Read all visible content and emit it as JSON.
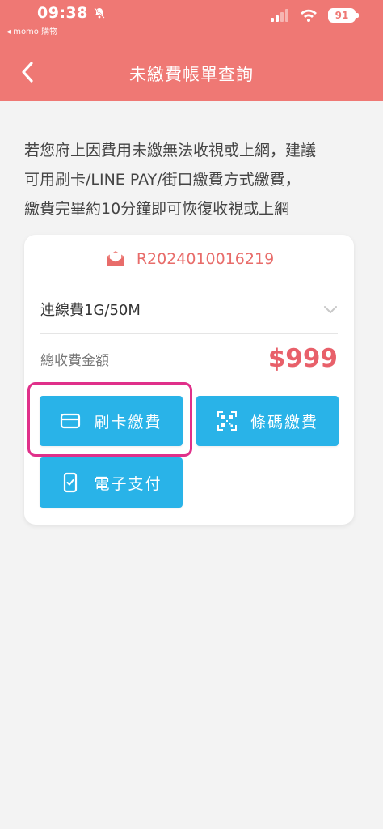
{
  "status_bar": {
    "time": "09:38",
    "back_app": "◂ momo 購物",
    "battery": "91"
  },
  "header": {
    "title": "未繳費帳單查詢"
  },
  "notice": {
    "line1": "若您府上因費用未繳無法收視或上網，建議",
    "line2": "可用刷卡/LINE PAY/街口繳費方式繳費，",
    "line3": "繳費完畢約10分鐘即可恢復收視或上網"
  },
  "bill": {
    "number": "R2024010016219",
    "plan": "連線費1G/50M",
    "total_label": "總收費金額",
    "total_amount": "$999"
  },
  "buttons": {
    "card_pay": "刷卡繳費",
    "barcode_pay": "條碼繳費",
    "epay": "電子支付"
  },
  "colors": {
    "header": "#ef7874",
    "accent_button": "#29b3e8",
    "amount": "#e8606a",
    "highlight": "#e0308a"
  }
}
